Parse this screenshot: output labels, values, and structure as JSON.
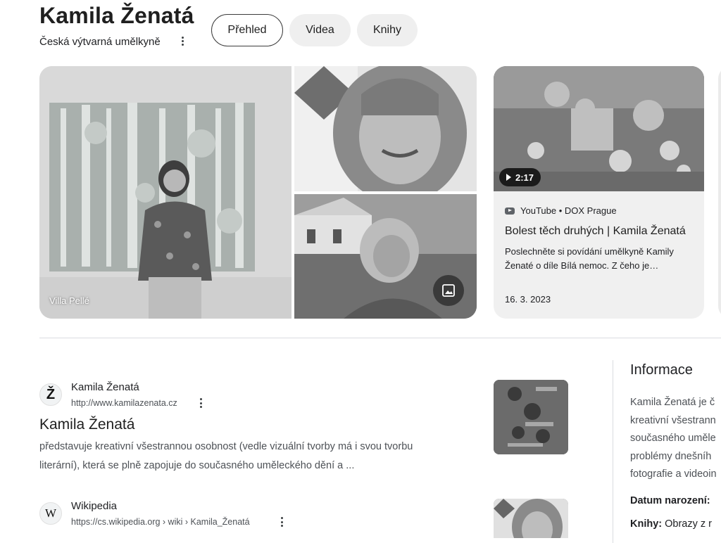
{
  "header": {
    "title": "Kamila Ženatá",
    "subtitle": "Česká výtvarná umělkyně",
    "tabs": [
      {
        "label": "Přehled",
        "active": true
      },
      {
        "label": "Videa",
        "active": false
      },
      {
        "label": "Knihy",
        "active": false
      }
    ]
  },
  "images": {
    "main_caption": "Villa Pellé",
    "image_search_icon": "image-icon"
  },
  "video": {
    "duration": "2:17",
    "source": "YouTube • DOX Prague",
    "title": "Bolest těch druhých | Kamila Ženatá",
    "description": "Poslechněte si povídání umělkyně Kamily Ženaté o díle Bílá nemoc. Z čeho je…",
    "date": "16. 3. 2023"
  },
  "results": [
    {
      "icon_letter": "Ž",
      "site_name": "Kamila Ženatá",
      "url": "http://www.kamilazenata.cz",
      "title": "Kamila Ženatá",
      "snippet_lines": [
        "představuje kreativní všestrannou osobnost (vedle vizuální tvorby má i svou tvorbu",
        "literární), která se plně zapojuje do současného uměleckého dění a ..."
      ]
    },
    {
      "icon_letter": "W",
      "site_name": "Wikipedia",
      "url": "https://cs.wikipedia.org › wiki › Kamila_Ženatá"
    }
  ],
  "info": {
    "heading": "Informace",
    "lines": [
      "Kamila Ženatá je č",
      "kreativní všestrann",
      "současného uměle",
      "problémy dnešníh",
      "fotografie a videoin"
    ],
    "born_label": "Datum narození:",
    "born_value": "",
    "books_label": "Knihy:",
    "books_value": "Obrazy z r"
  },
  "colors": {
    "chip_inactive": "#efefef",
    "text_primary": "#202124",
    "text_secondary": "#4d5156"
  }
}
